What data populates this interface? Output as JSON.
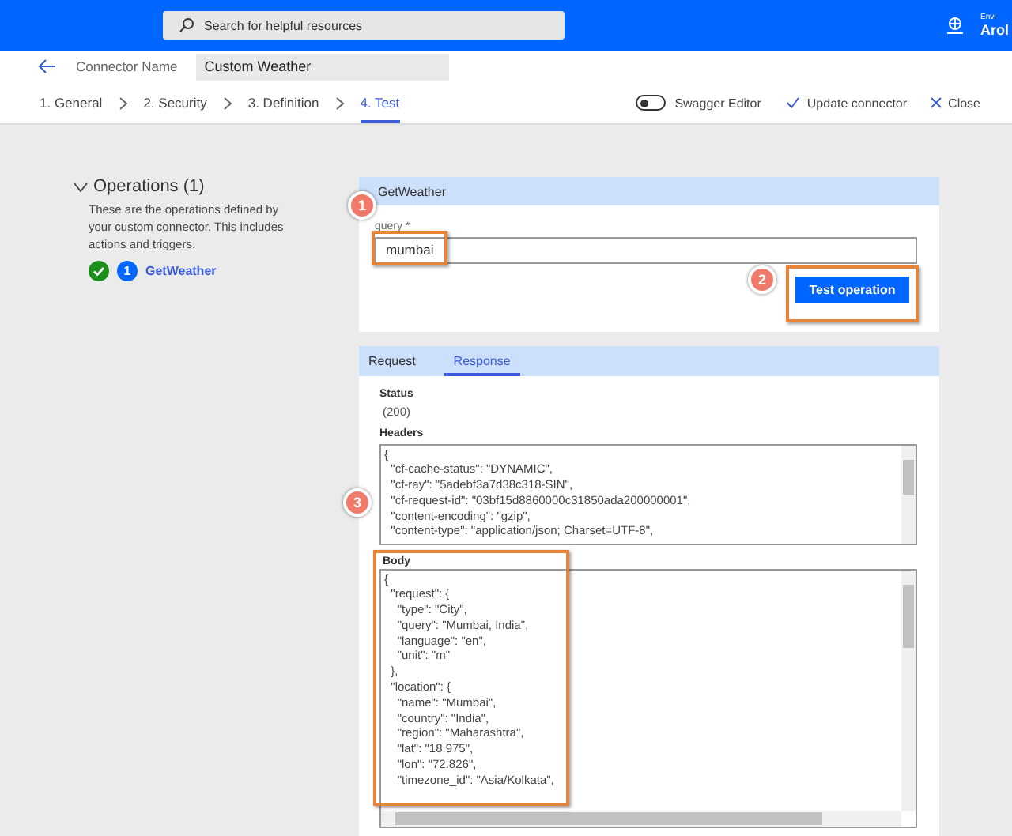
{
  "top_bar": {
    "search": {
      "placeholder": "Search for helpful resources"
    },
    "environment_label": "Envi",
    "environment_name": "Arol"
  },
  "connector": {
    "label": "Connector Name",
    "value": "Custom Weather"
  },
  "steps": [
    {
      "label": "1. General",
      "selected": false
    },
    {
      "label": "2. Security",
      "selected": false
    },
    {
      "label": "3. Definition",
      "selected": false
    },
    {
      "label": "4. Test",
      "selected": true
    }
  ],
  "swagger_editor": {
    "label": "Swagger Editor",
    "on": false
  },
  "actions": [
    {
      "kind": "update",
      "label": "Update connector"
    },
    {
      "kind": "close",
      "label": "Close"
    }
  ],
  "operations": {
    "title": "Operations (1)",
    "expanded": true,
    "description": "These are the operations defined by your custom connector. This includes actions and triggers.",
    "items": [
      {
        "number": "1",
        "name": "GetWeather",
        "passed": true
      }
    ]
  },
  "operation_card": {
    "title": "GetWeather",
    "field": {
      "label": "query *",
      "value": "mumbai",
      "marker": "1"
    },
    "button": "Test operation",
    "button_marker": "2"
  },
  "response_tabs": [
    {
      "label": "Request",
      "selected": false
    },
    {
      "label": "Response",
      "selected": true
    }
  ],
  "response": {
    "status_label": "Status",
    "status": "(200)",
    "headers_label": "Headers",
    "headers": [
      "{",
      "  \"cf-cache-status\": \"DYNAMIC\",",
      "  \"cf-ray\": \"5adebf3a7d38c318-SIN\",",
      "  \"cf-request-id\": \"03bf15d8860000c31850ada200000001\",",
      "  \"content-encoding\": \"gzip\",",
      "  \"content-type\": \"application/json; Charset=UTF-8\","
    ],
    "body_label": "Body",
    "body_marker": "3",
    "body": [
      "{",
      "  \"request\": {",
      "    \"type\": \"City\",",
      "    \"query\": \"Mumbai, India\",",
      "    \"language\": \"en\",",
      "    \"unit\": \"m\"",
      "  },",
      "  \"location\": {",
      "    \"name\": \"Mumbai\",",
      "    \"country\": \"India\",",
      "    \"region\": \"Maharashtra\",",
      "    \"lat\": \"18.975\",",
      "    \"lon\": \"72.826\",",
      "    \"timezone_id\": \"Asia/Kolkata\","
    ]
  }
}
